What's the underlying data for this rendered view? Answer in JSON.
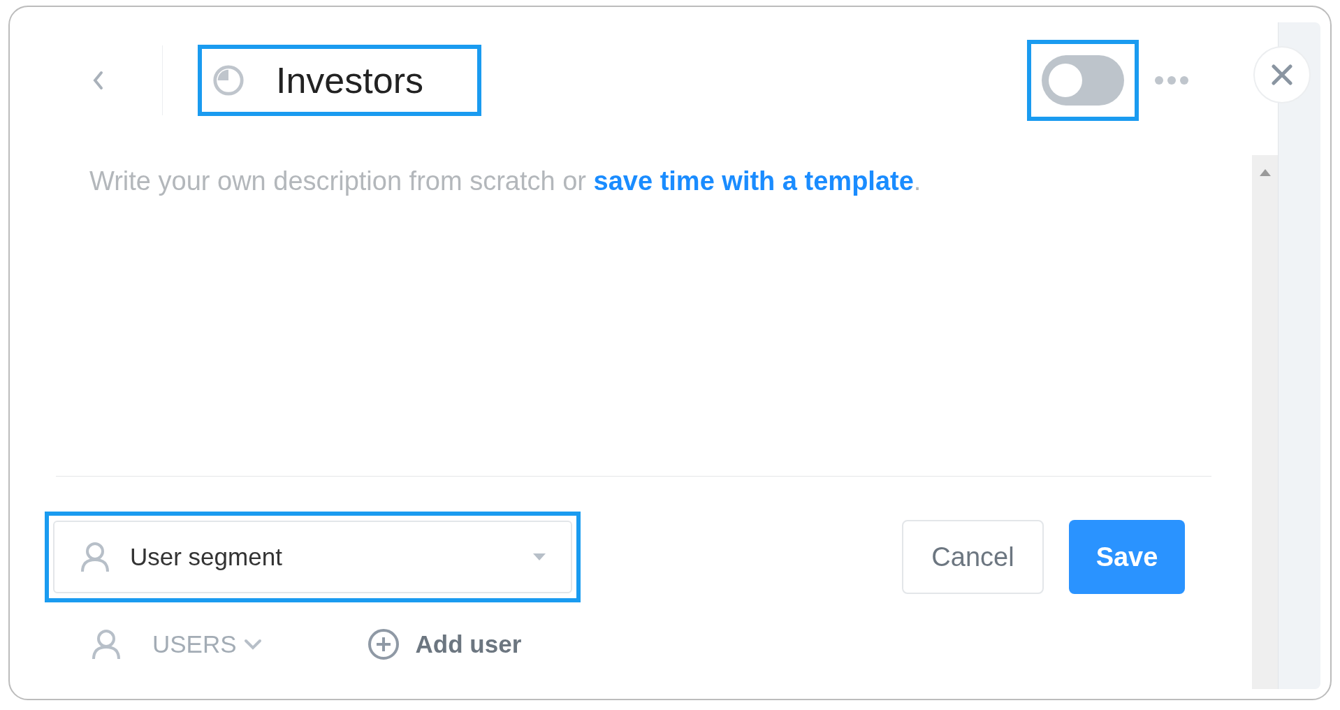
{
  "header": {
    "title": "Investors",
    "title_highlighted": true,
    "toggle": {
      "on": false,
      "highlighted": true
    }
  },
  "description": {
    "text": "Write your own description from scratch or ",
    "link": "save time with a template",
    "end": "."
  },
  "segment": {
    "label": "User segment",
    "highlighted": true
  },
  "buttons": {
    "cancel": "Cancel",
    "save": "Save"
  },
  "users": {
    "label": "USERS",
    "add": "Add user"
  }
}
